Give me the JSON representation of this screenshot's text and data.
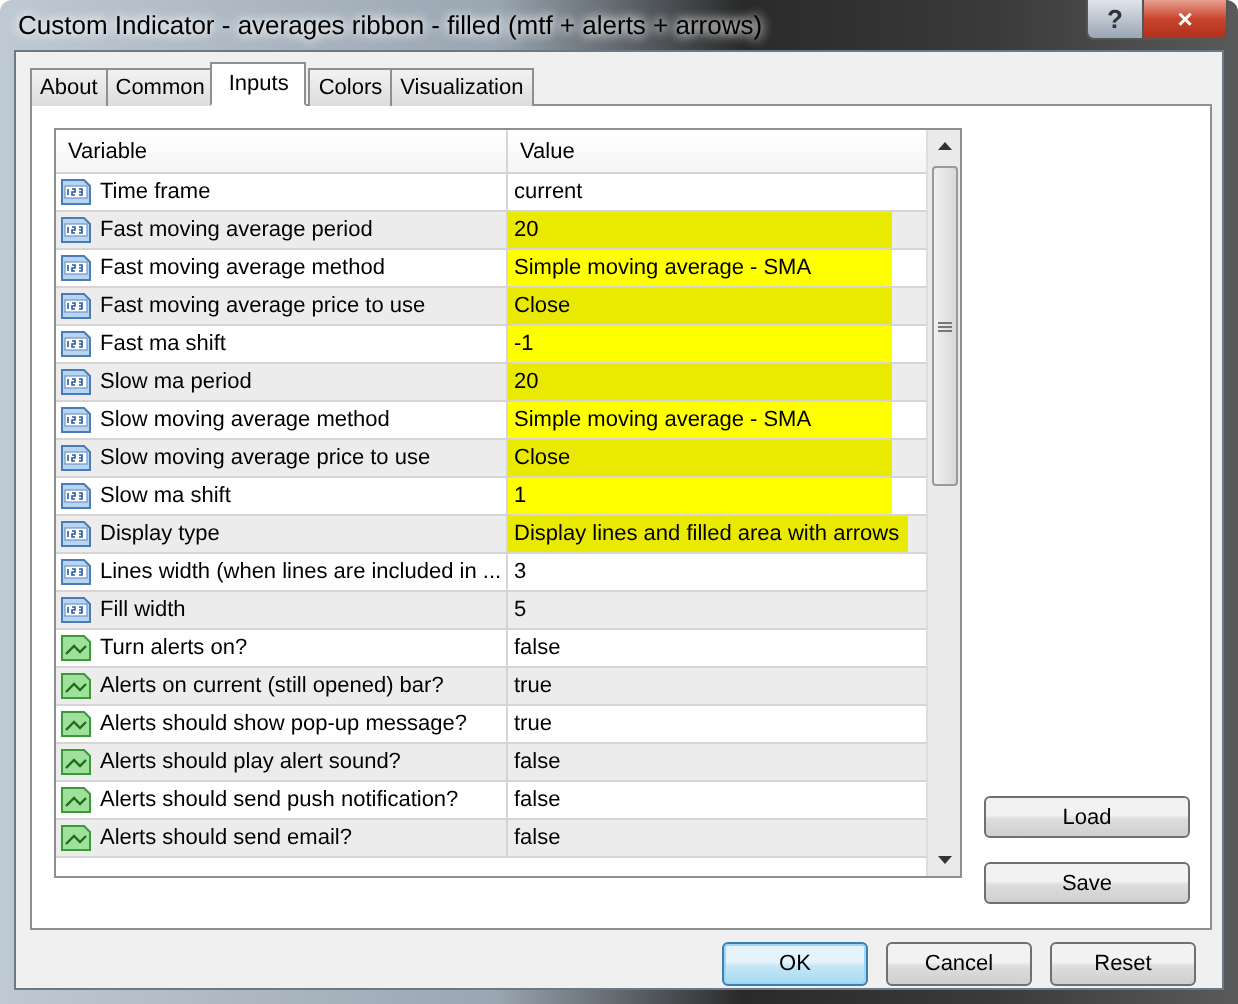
{
  "window": {
    "title": "Custom Indicator - averages ribbon - filled (mtf + alerts + arrows)",
    "controls": [
      "?",
      "×"
    ]
  },
  "tabs": [
    {
      "label": "About",
      "selected": false
    },
    {
      "label": "Common",
      "selected": false
    },
    {
      "label": "Inputs",
      "selected": true
    },
    {
      "label": "Colors",
      "selected": false
    },
    {
      "label": "Visualization",
      "selected": false
    }
  ],
  "table": {
    "columns": [
      "Variable",
      "Value"
    ],
    "rows": [
      {
        "kind": "number",
        "variable": "Time frame",
        "value": "current",
        "highlighted": false
      },
      {
        "kind": "number",
        "variable": "Fast moving average period",
        "value": "20",
        "highlighted": true
      },
      {
        "kind": "number",
        "variable": "Fast moving average method",
        "value": "Simple moving average - SMA",
        "highlighted": true
      },
      {
        "kind": "number",
        "variable": "Fast moving average price to use",
        "value": "Close",
        "highlighted": true
      },
      {
        "kind": "number",
        "variable": "Fast ma shift",
        "value": "-1",
        "highlighted": true
      },
      {
        "kind": "number",
        "variable": "Slow ma period",
        "value": "20",
        "highlighted": true
      },
      {
        "kind": "number",
        "variable": "Slow moving average method",
        "value": "Simple moving average - SMA",
        "highlighted": true
      },
      {
        "kind": "number",
        "variable": "Slow moving average price to use",
        "value": "Close",
        "highlighted": true
      },
      {
        "kind": "number",
        "variable": "Slow ma shift",
        "value": "1",
        "highlighted": true
      },
      {
        "kind": "number",
        "variable": "Display type",
        "value": "Display lines and filled area with arrows",
        "highlighted": true
      },
      {
        "kind": "number",
        "variable": "Lines width (when lines are included in ...",
        "value": "3",
        "highlighted": false
      },
      {
        "kind": "number",
        "variable": "Fill width",
        "value": "5",
        "highlighted": false
      },
      {
        "kind": "bool",
        "variable": "Turn alerts on?",
        "value": "false",
        "highlighted": false
      },
      {
        "kind": "bool",
        "variable": "Alerts on current (still opened) bar?",
        "value": "true",
        "highlighted": false
      },
      {
        "kind": "bool",
        "variable": "Alerts should show pop-up message?",
        "value": "true",
        "highlighted": false
      },
      {
        "kind": "bool",
        "variable": "Alerts should play alert sound?",
        "value": "false",
        "highlighted": false
      },
      {
        "kind": "bool",
        "variable": "Alerts should send push notification?",
        "value": "false",
        "highlighted": false
      },
      {
        "kind": "bool",
        "variable": "Alerts should send email?",
        "value": "false",
        "highlighted": false
      }
    ]
  },
  "side_buttons": [
    "Load",
    "Save"
  ],
  "buttons": [
    {
      "label": "OK",
      "default": true
    },
    {
      "label": "Cancel",
      "default": false
    },
    {
      "label": "Reset",
      "default": false
    }
  ]
}
